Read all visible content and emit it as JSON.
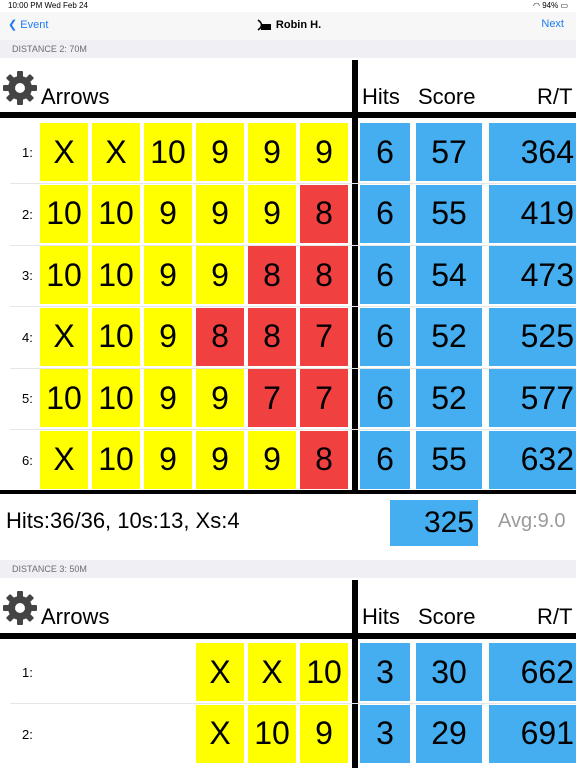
{
  "status": {
    "time": "10:00 PM",
    "date": "Wed Feb 24",
    "battery": "94%"
  },
  "nav": {
    "back": "Event",
    "title": "Robin H.",
    "next": "Next"
  },
  "headers": {
    "arrows": "Arrows",
    "hits": "Hits",
    "score": "Score",
    "rt": "R/T"
  },
  "distance2": {
    "title": "DISTANCE 2: 70M",
    "rows": [
      {
        "num": "1:",
        "arrows": [
          "X",
          "X",
          "10",
          "9",
          "9",
          "9"
        ],
        "hits": "6",
        "score": "57",
        "rt": "364"
      },
      {
        "num": "2:",
        "arrows": [
          "10",
          "10",
          "9",
          "9",
          "9",
          "8"
        ],
        "hits": "6",
        "score": "55",
        "rt": "419"
      },
      {
        "num": "3:",
        "arrows": [
          "10",
          "10",
          "9",
          "9",
          "8",
          "8"
        ],
        "hits": "6",
        "score": "54",
        "rt": "473"
      },
      {
        "num": "4:",
        "arrows": [
          "X",
          "10",
          "9",
          "8",
          "8",
          "7"
        ],
        "hits": "6",
        "score": "52",
        "rt": "525"
      },
      {
        "num": "5:",
        "arrows": [
          "10",
          "10",
          "9",
          "9",
          "7",
          "7"
        ],
        "hits": "6",
        "score": "52",
        "rt": "577"
      },
      {
        "num": "6:",
        "arrows": [
          "X",
          "10",
          "9",
          "9",
          "9",
          "8"
        ],
        "hits": "6",
        "score": "55",
        "rt": "632"
      }
    ],
    "summary": "Hits:36/36, 10s:13, Xs:4",
    "total": "325",
    "avg": "Avg:9.0"
  },
  "distance3": {
    "title": "DISTANCE 3: 50M",
    "rows": [
      {
        "num": "1:",
        "arrows": [
          "X",
          "X",
          "10"
        ],
        "hits": "3",
        "score": "30",
        "rt": "662"
      },
      {
        "num": "2:",
        "arrows": [
          "X",
          "10",
          "9"
        ],
        "hits": "3",
        "score": "29",
        "rt": "691"
      }
    ]
  },
  "colors": {
    "gold": "#ffff00",
    "red": "#f04040",
    "blue": "#45aef0",
    "link": "#1e7bf0"
  }
}
